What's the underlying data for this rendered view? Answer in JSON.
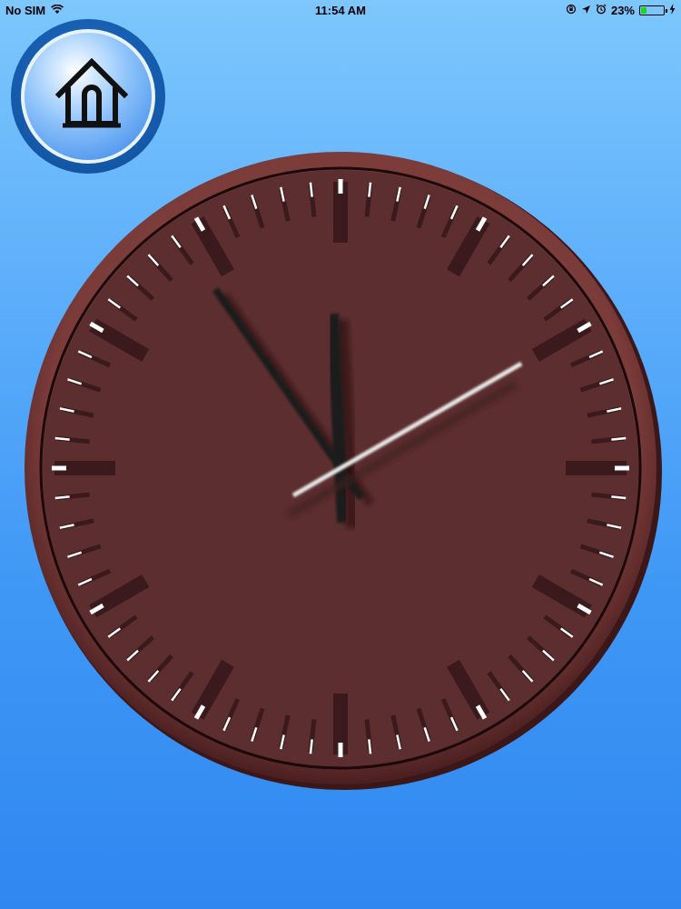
{
  "status_bar": {
    "carrier": "No SIM",
    "time": "11:54 AM",
    "battery_percent_label": "23%",
    "battery_level": 0.23,
    "icons": [
      "wifi-icon",
      "orientation-lock-icon",
      "location-icon",
      "alarm-icon",
      "battery-icon",
      "charging-icon"
    ]
  },
  "home_button": {
    "icon": "home-icon"
  },
  "clock": {
    "type": "analog",
    "hour": 11,
    "minute": 54,
    "second": 10,
    "colors": {
      "face": "#5d2e30",
      "rim": "#7a3a38",
      "tick_white": "#ffffff",
      "tick_dark": "#3a1a1c",
      "hands": "#1f1f1f",
      "second_hand": "#e8e8e8"
    }
  },
  "colors": {
    "background_top": "#7dc7fd",
    "background_bottom": "#2f88f0"
  }
}
